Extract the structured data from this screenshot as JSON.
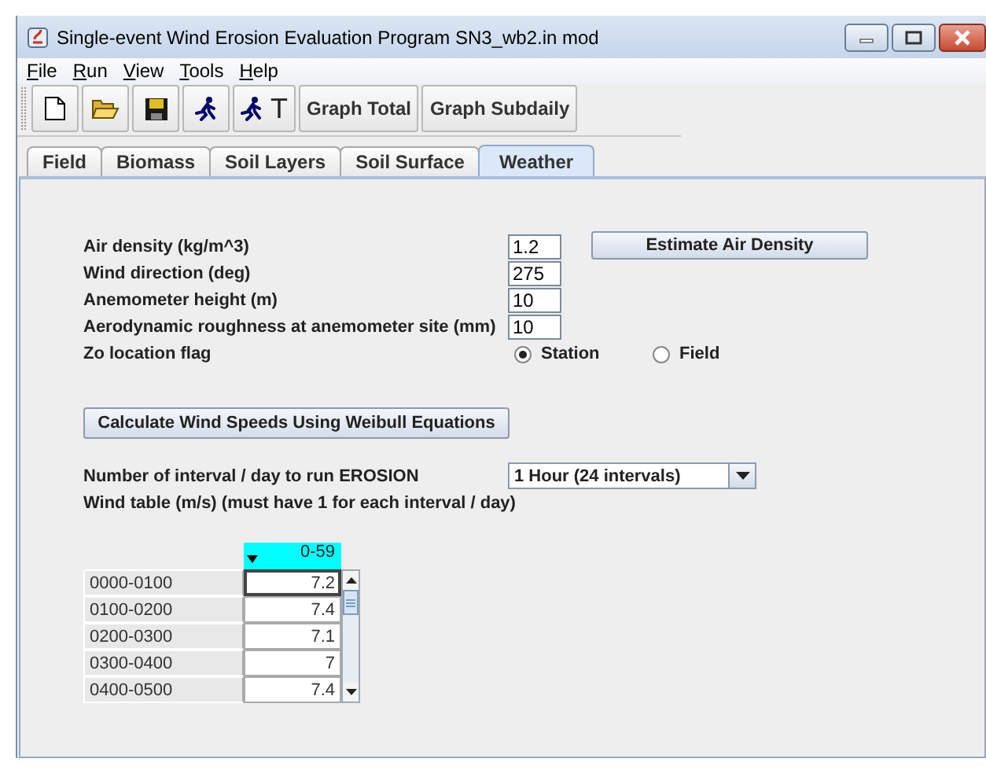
{
  "window": {
    "title": "Single-event Wind Erosion Evaluation Program SN3_wb2.in mod"
  },
  "menu": [
    {
      "label": "File"
    },
    {
      "label": "Run"
    },
    {
      "label": "View"
    },
    {
      "label": "Tools"
    },
    {
      "label": "Help"
    }
  ],
  "toolbar": [
    {
      "kind": "new"
    },
    {
      "kind": "open"
    },
    {
      "kind": "save"
    },
    {
      "kind": "run"
    },
    {
      "kind": "run-text",
      "label": "T"
    },
    {
      "kind": "text",
      "label": "Graph Total"
    },
    {
      "kind": "text",
      "label": "Graph Subdaily"
    }
  ],
  "tabs": [
    {
      "label": "Field",
      "selected": false
    },
    {
      "label": "Biomass",
      "selected": false
    },
    {
      "label": "Soil Layers",
      "selected": false
    },
    {
      "label": "Soil Surface",
      "selected": false
    },
    {
      "label": "Weather",
      "selected": true
    }
  ],
  "weather": {
    "fields": [
      {
        "label": "Air density (kg/m^3)",
        "value": "1.2"
      },
      {
        "label": "Wind direction (deg)",
        "value": "275"
      },
      {
        "label": "Anemometer height (m)",
        "value": "10"
      },
      {
        "label": "Aerodynamic roughness at anemometer site (mm)",
        "value": "10"
      }
    ],
    "estimate_button": "Estimate Air Density",
    "zo_flag": {
      "label": "Zo location flag",
      "options": [
        {
          "label": "Station",
          "selected": true
        },
        {
          "label": "Field",
          "selected": false
        }
      ]
    },
    "calculate_button": "Calculate Wind Speeds Using Weibull Equations",
    "interval": {
      "label": "Number of interval / day to run EROSION",
      "value": "1 Hour (24 intervals)"
    },
    "wind_table_label": "Wind table (m/s)  (must have 1 for each interval / day)",
    "wind_table": {
      "column": "0-59",
      "rows": [
        {
          "label": "0000-0100",
          "value": "7.2",
          "focused": true
        },
        {
          "label": "0100-0200",
          "value": "7.4",
          "focused": false
        },
        {
          "label": "0200-0300",
          "value": "7.1",
          "focused": false
        },
        {
          "label": "0300-0400",
          "value": "7",
          "focused": false
        },
        {
          "label": "0400-0500",
          "value": "7.4",
          "focused": false
        }
      ]
    }
  }
}
